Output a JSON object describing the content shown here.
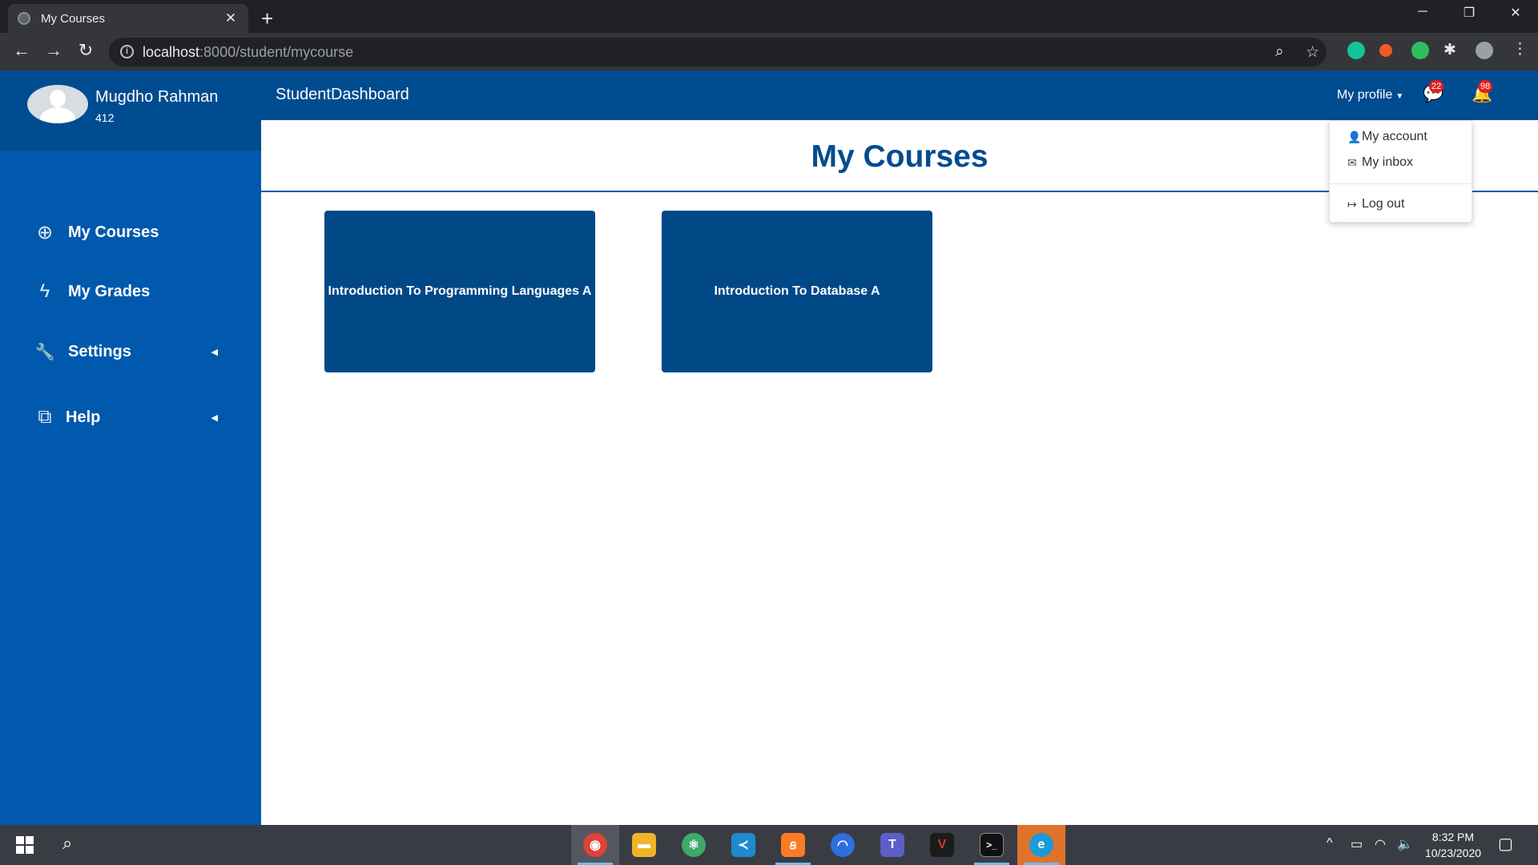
{
  "browser": {
    "tab_title": "My Courses",
    "tab_close": "✕",
    "new_tab": "+",
    "url_host": "localhost",
    "url_path": ":8000/student/mycourse",
    "window_controls": {
      "minimize": "─",
      "restore": "❐",
      "close": "✕"
    }
  },
  "user": {
    "name": "Mugdho Rahman",
    "id": "412"
  },
  "sidebar": {
    "items": [
      {
        "label": "My Courses",
        "icon": "life-ring-icon",
        "glyph": "⊕"
      },
      {
        "label": "My Grades",
        "icon": "bolt-icon",
        "glyph": "ϟ"
      },
      {
        "label": "Settings",
        "icon": "wrench-icon",
        "glyph": "🔧",
        "arrow": "◀"
      },
      {
        "label": "Help",
        "icon": "windows-restore-icon",
        "glyph": "⧉",
        "arrow": "◀"
      }
    ]
  },
  "navbar": {
    "brand": "StudentDashboard",
    "profile_label": "My profile",
    "caret": "▼",
    "messages_badge": "22",
    "notifications_badge": "98"
  },
  "page": {
    "title": "My Courses"
  },
  "courses": [
    {
      "title": "Introduction To Programming Languages A"
    },
    {
      "title": "Introduction To Database A"
    }
  ],
  "profile_menu": {
    "items": [
      {
        "label": "My account",
        "icon": "user-icon",
        "glyph": "👤"
      },
      {
        "label": "My inbox",
        "icon": "envelope-icon",
        "glyph": "✉"
      },
      {
        "label": "Log out",
        "icon": "sign-out-icon",
        "glyph": "↦"
      }
    ]
  },
  "taskbar": {
    "time": "8:32 PM",
    "date": "10/23/2020",
    "apps": [
      {
        "name": "chrome",
        "glyph": "◉",
        "color": "#db4437"
      },
      {
        "name": "file-explorer",
        "glyph": "▬",
        "color": "#f0b429"
      },
      {
        "name": "atom",
        "glyph": "⚛",
        "color": "#3fa86b"
      },
      {
        "name": "vscode",
        "glyph": "≺",
        "color": "#1f8ad2"
      },
      {
        "name": "xampp",
        "glyph": "ꞩ",
        "color": "#fb7a24"
      },
      {
        "name": "app-blue-circle",
        "glyph": "◠",
        "color": "#2f6fdb"
      },
      {
        "name": "teams",
        "glyph": "T",
        "color": "#5b5fc7"
      },
      {
        "name": "valorant",
        "glyph": "V",
        "color": "#d13639"
      },
      {
        "name": "terminal",
        "glyph": ">_",
        "color": "#111111"
      },
      {
        "name": "edge",
        "glyph": "e",
        "color": "#1c9ad6"
      }
    ]
  },
  "colors": {
    "sidebar": "#0059ad",
    "navbar": "#004c90",
    "card": "#004886",
    "badge": "#e21f1f"
  }
}
